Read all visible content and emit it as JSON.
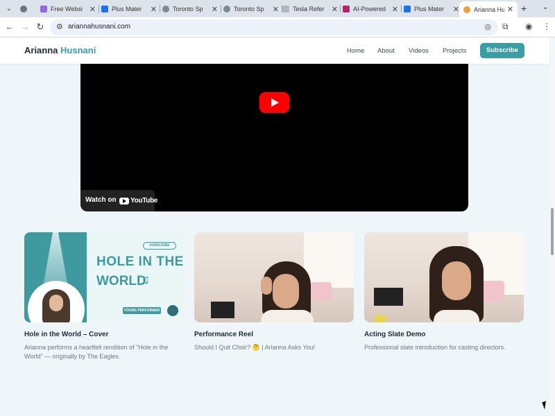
{
  "browser": {
    "tabs": [
      {
        "title": "Free Websi",
        "color": "#8e6bd8"
      },
      {
        "title": "Plus Mater",
        "color": "#1a73e8"
      },
      {
        "title": "Toronto Sp",
        "color": "#7c8a96"
      },
      {
        "title": "Toronto Sp",
        "color": "#7c8a96"
      },
      {
        "title": "Tesla Refer",
        "color": "#b0b7bf"
      },
      {
        "title": "AI-Powered",
        "color": "#b4246a"
      },
      {
        "title": "Plus Mater",
        "color": "#1a73e8"
      },
      {
        "title": "Arianna Hu",
        "color": "#e8a33a",
        "active": true
      }
    ],
    "url": "ariannahusnani.com"
  },
  "header": {
    "brand_first": "Arianna",
    "brand_last": "Husnani",
    "nav": [
      "Home",
      "About",
      "Videos",
      "Projects"
    ],
    "subscribe_label": "Subscribe"
  },
  "video": {
    "watch_on": "Watch on",
    "youtube": "YouTube"
  },
  "cards": [
    {
      "title": "Hole in the World – Cover",
      "desc": "Arianna performs a heartfelt rendition of \"Hole in the World\" — originally by The Eagles.",
      "thumb": {
        "subscribe": "SUBSCRIBE",
        "line1": "HOLE IN THE",
        "line2": "WORLD",
        "note": "♫",
        "tag": "YOUNG PERFORMER"
      }
    },
    {
      "title": "Performance Reel",
      "desc": "Should I Quit Choir? 🤔 | Arianna Asks You!"
    },
    {
      "title": "Acting Slate Demo",
      "desc": "Professional slate introduction for casting directors."
    }
  ],
  "colors": {
    "accent": "#3a9ea5",
    "play": "#ff0000"
  }
}
